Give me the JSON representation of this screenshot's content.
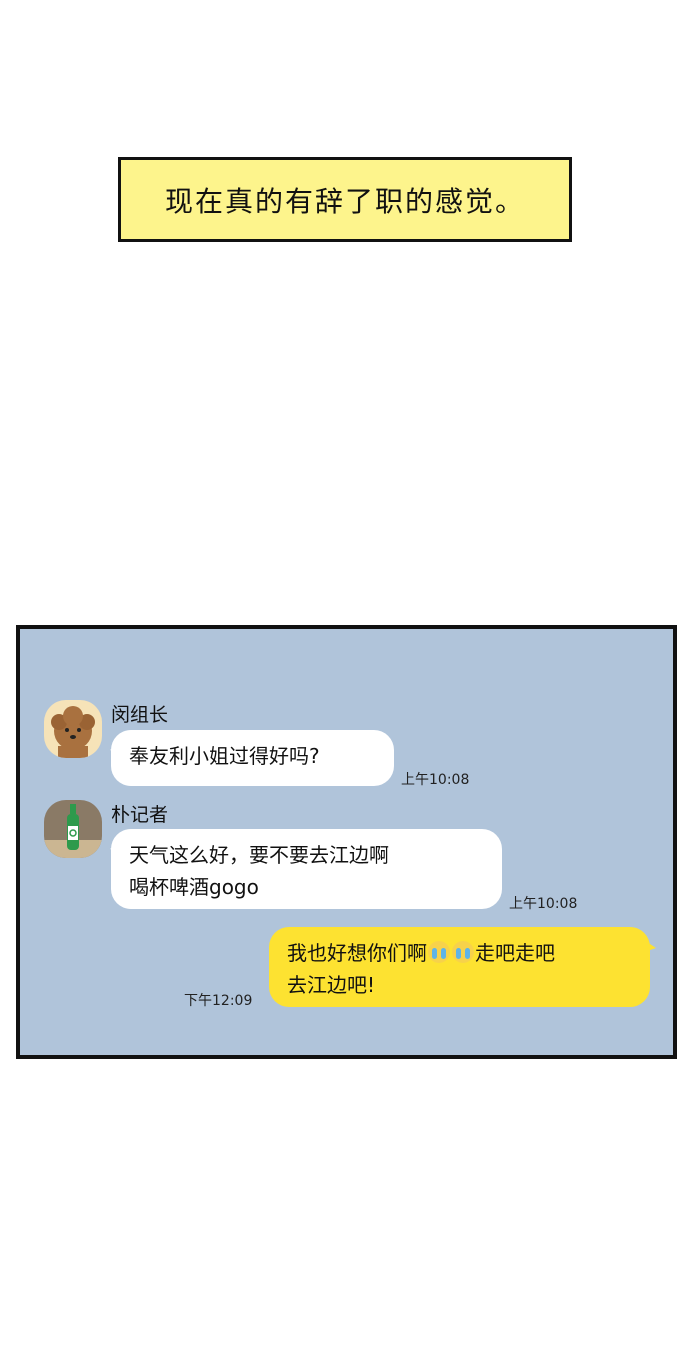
{
  "caption": "现在真的有辞了职的感觉。",
  "chat": {
    "messages": [
      {
        "sender": "闵组长",
        "lines": [
          "奉友利小姐过得好吗?"
        ],
        "time": "上午10:08"
      },
      {
        "sender": "朴记者",
        "lines": [
          "天气这么好，要不要去江边啊",
          "喝杯啤酒gogo"
        ],
        "time": "上午10:08"
      },
      {
        "line1_part1": "我也好想你们啊",
        "line1_part2": "走吧走吧",
        "line2": "去江边吧!",
        "time": "下午12:09",
        "emoji": [
          "crying-face-icon",
          "crying-face-icon"
        ]
      }
    ]
  },
  "colors": {
    "caption_bg": "#fdf48c",
    "chat_bg": "#b0c4da",
    "my_bubble": "#fde231",
    "their_bubble": "#ffffff"
  }
}
